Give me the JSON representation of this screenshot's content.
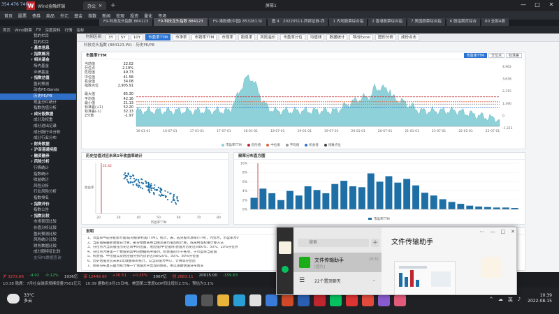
{
  "window": {
    "left_title": "354 476 746",
    "app_logo": "W",
    "app_title": "Wind金融终端",
    "browser_tab": "办公",
    "center_title": "屏幕1",
    "controls": [
      "—",
      "□",
      "✕"
    ]
  },
  "menu": [
    "首页",
    "股票",
    "债券",
    "商品",
    "外汇",
    "基金",
    "指数",
    "新闻",
    "宏观",
    "投资",
    "量化",
    "市场"
  ],
  "toptabs": [
    {
      "label": "F9-科技龙头指数 884123",
      "active": false
    },
    {
      "label": "F9-科技龙头指数 884123",
      "active": true
    },
    {
      "label": "F9-港股通(中国) 853281.SI",
      "active": false
    },
    {
      "label": "图 4-科技龙头指数分",
      "active": false
    }
  ],
  "rightstrip": [
    "20220511-西部证券-西",
    "1 内地股票综合指",
    "2 香港股票综合指",
    "7 美国股票综合指",
    "6 股指期货综合",
    "60 全部A股"
  ],
  "bar2": [
    "首页",
    "Wind股票",
    "F9",
    "深度资料",
    "行情",
    "指标"
  ],
  "sidebar": {
    "items": [
      {
        "label": "我的栏目",
        "type": "sub"
      },
      {
        "label": "我的栏目",
        "type": "sub"
      },
      {
        "label": "基本信息",
        "type": "head"
      },
      {
        "label": "指数概况",
        "type": "head"
      },
      {
        "label": "相关基金",
        "type": "head"
      },
      {
        "label": "场内基金",
        "type": "sub"
      },
      {
        "label": "业绩基金",
        "type": "sub"
      },
      {
        "label": "指数估值",
        "type": "head"
      },
      {
        "label": "盈利预测",
        "type": "sub"
      },
      {
        "label": "动态PE-Bands",
        "type": "sub"
      },
      {
        "label": "历史PE/PB",
        "type": "active"
      },
      {
        "label": "现金分红统计",
        "type": "sub"
      },
      {
        "label": "指数估值分析",
        "type": "sub"
      },
      {
        "label": "成分股数据",
        "type": "head"
      },
      {
        "label": "成分及权重",
        "type": "sub"
      },
      {
        "label": "成分进出记录",
        "type": "sub"
      },
      {
        "label": "成分股行业分析",
        "type": "sub"
      },
      {
        "label": "成分行业分布",
        "type": "sub"
      },
      {
        "label": "财务数据",
        "type": "head"
      },
      {
        "label": "沪深港通持股",
        "type": "head"
      },
      {
        "label": "融资融券",
        "type": "head"
      },
      {
        "label": "风险分析",
        "type": "head"
      },
      {
        "label": "行情统计",
        "type": "sub"
      },
      {
        "label": "指数统计",
        "type": "sub"
      },
      {
        "label": "收益统计",
        "type": "sub"
      },
      {
        "label": "风险分析",
        "type": "sub"
      },
      {
        "label": "行业风险分析",
        "type": "sub"
      },
      {
        "label": "指数排名",
        "type": "sub"
      },
      {
        "label": "指数评价",
        "type": "head"
      },
      {
        "label": "指数公告",
        "type": "sub"
      },
      {
        "label": "指数比较",
        "type": "head"
      },
      {
        "label": "市场表现比较",
        "type": "sub"
      },
      {
        "label": "价值分析比较",
        "type": "sub"
      },
      {
        "label": "盈利预测比较",
        "type": "sub"
      },
      {
        "label": "风险统计比较",
        "type": "sub"
      },
      {
        "label": "财务数据比较",
        "type": "sub"
      },
      {
        "label": "成分股特征比较",
        "type": "sub"
      },
      {
        "label": "支持F9数据查询",
        "type": "ph"
      }
    ]
  },
  "toolbar": {
    "items": [
      "时间区间",
      "3Y",
      "5Y",
      "10Y",
      "市盈率TTM",
      "市净率",
      "市销率TTM",
      "市现率",
      "股息率",
      "风险溢价",
      "市盈率分位",
      "均值线",
      "数据统计",
      "导出Excel",
      "图形分析",
      "成份点击"
    ],
    "active_index": 4
  },
  "subtitle": "科技龙头指数 (884123.WI) - 历史PE/PB",
  "top_panel": {
    "title": "市盈率TTM",
    "buttons": [
      "市盈率TTM",
      "分位点",
      "标准差"
    ],
    "active_button": 0,
    "stats": [
      {
        "k": "当前值",
        "v": "22.02"
      },
      {
        "k": "分位点",
        "v": "2.19%"
      },
      {
        "k": "危险值",
        "v": "49.73"
      },
      {
        "k": "中位值",
        "v": "41.58"
      },
      {
        "k": "机会值",
        "v": "34.08"
      },
      {
        "k": "指数点位",
        "v": "2,905.91"
      },
      {
        "k": "",
        "v": ""
      },
      {
        "k": "最大值",
        "v": "85.30"
      },
      {
        "k": "平均值",
        "v": "42.16"
      },
      {
        "k": "最小值",
        "v": "21.13"
      },
      {
        "k": "标准差(+1)",
        "v": "52.20"
      },
      {
        "k": "标准差(-1)",
        "v": "32.13"
      },
      {
        "k": "Z分数",
        "v": "-1.97"
      }
    ],
    "legend": [
      "市盈率TTM",
      "危险值",
      "中位值",
      "平均值",
      "机会值",
      "指数点位"
    ],
    "x_ticks": [
      "16-01-01",
      "16-07-01",
      "17-01-01",
      "17-07-01",
      "18-01-01",
      "18-07-01",
      "19-01-01",
      "19-07-01",
      "20-01-01",
      "20-07-01",
      "21-01-01",
      "21-07-01",
      "22-01-01",
      "22-07-01"
    ],
    "y_ticks_right": [
      "4,962",
      "3,638",
      "2,315",
      "1,490",
      "0",
      "-1,323"
    ]
  },
  "scatter_panel": {
    "title": "历史估值对应未来1年收益率统计",
    "y_label": "收益率",
    "x_label": "市盈率TTM",
    "marker": "22.42",
    "x_ticks": [
      "20",
      "30",
      "40",
      "50",
      "60",
      "70",
      "80"
    ]
  },
  "hist_panel": {
    "title": "频率分布直方图",
    "legend": "市盈率TTM",
    "y_ticks": [
      "10%",
      "8%",
      "6%",
      "4%",
      "2%",
      "0%"
    ]
  },
  "notes": {
    "title": "说明",
    "lines": [
      "1、市盈率=成分股总市值/成分股净利润(TTM)，统计、表、成分股市净率(TTM)，为负时，市盈率为0",
      "2、当前值按最新收盘日计算，部分指数采用自由流通市值加权计算，或采用等权重计算方法",
      "3、分位点为当前值在历史区间中的位置，危险值/中位值/机会值为历史区间80%、50%、20%分位点",
      "4、分位点为将第一个数值到其中的数据有序排列，机会值的小于各项，于市盈率当前值",
      "5、机会值、中位值以及危险值分别为历史区间的20%、50%、80%分位值",
      "6、历史估值对应未来1年收益率的统计，以当前值为中心，计算等分位后",
      "7、频率分布直方图为统计每一个估值水平出现的频率，用以观察估值分布情况"
    ]
  },
  "statusbar": {
    "row1": [
      {
        "t": "沪 3272.66",
        "c": "up"
      },
      {
        "t": "-4.02",
        "c": "down"
      },
      {
        "t": "-0.12%",
        "c": "down"
      },
      {
        "t": "1936亿",
        "c": ""
      },
      {
        "t": "深 12449.90",
        "c": "up"
      },
      {
        "t": "+30.51",
        "c": "up"
      },
      {
        "t": "+0.25%",
        "c": "up"
      },
      {
        "t": "3067亿",
        "c": ""
      },
      {
        "t": "创 2883.11",
        "c": "up"
      },
      {
        "t": "20015.00",
        "c": ""
      },
      {
        "t": "-159.63",
        "c": "down"
      }
    ],
    "row2": [
      "10:38 隐鹿：7月社会融资规模增量7561亿元",
      "10:39 据数社8月15日电，美国第二季度GDP同比增长2.5%，预估为3.1%"
    ]
  },
  "taskbar": {
    "temp": "33°C",
    "weather": "多云",
    "time": "10:39",
    "date": "2022-08-15",
    "tray": [
      "^",
      "☁",
      "英",
      "♪"
    ]
  },
  "wechat": {
    "search_placeholder": "搜索",
    "contact1": "文件传输助手",
    "contact1_sub": "[图片]",
    "contact1_time": "10:31",
    "contact2": "22个置顶聊天",
    "chat_title": "文件传输助手",
    "controls": [
      "⋯",
      "—",
      "□",
      "✕"
    ]
  },
  "colors": {
    "accent": "#2b73d2",
    "area": "#8fd1d8",
    "danger": "#c0262d",
    "bar": "#1d6fa5"
  }
}
